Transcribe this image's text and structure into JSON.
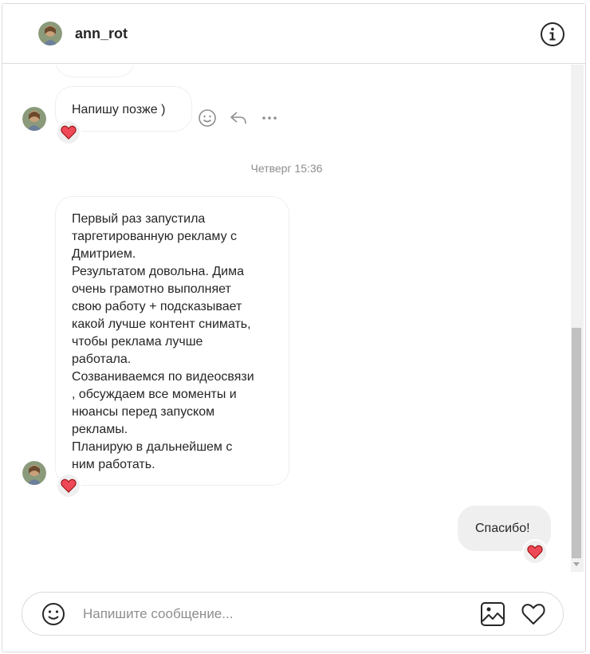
{
  "header": {
    "username": "ann_rot",
    "avatar_icon": "profile-avatar",
    "info_icon": "info-icon"
  },
  "messages": [
    {
      "id": "m0",
      "sender": "ann_rot",
      "text": "",
      "note": "partially scrolled out"
    },
    {
      "id": "m1",
      "sender": "ann_rot",
      "text": "Напишу позже )",
      "reaction": "heart"
    },
    {
      "id": "m2",
      "sender": "ann_rot",
      "text": "Первый раз запустила\nтаргетированную рекламу с\nДмитрием.\nРезультатом довольна. Дима\nочень грамотно выполняет\nсвою работу + подсказывает\nкакой лучше контент снимать,\nчтобы реклама лучше\nработала.\nСозваниваемся по видеосвязи\n, обсуждаем все моменты и\nнюансы перед запуском\nрекламы.\nПланирую в дальнейшем с\nним работать.",
      "reaction": "heart"
    },
    {
      "id": "m3",
      "sender": "me",
      "text": "Спасибо!",
      "reaction": "heart"
    }
  ],
  "timestamp": "Четверг 15:36",
  "hover_actions": [
    "smile-icon",
    "reply-icon",
    "more-icon"
  ],
  "composer": {
    "placeholder": "Напишите сообщение...",
    "value": ""
  },
  "colors": {
    "heart": "#ed4956",
    "border": "#dbdbdb",
    "own_bubble": "#efefef",
    "muted_text": "#8e8e8e"
  }
}
